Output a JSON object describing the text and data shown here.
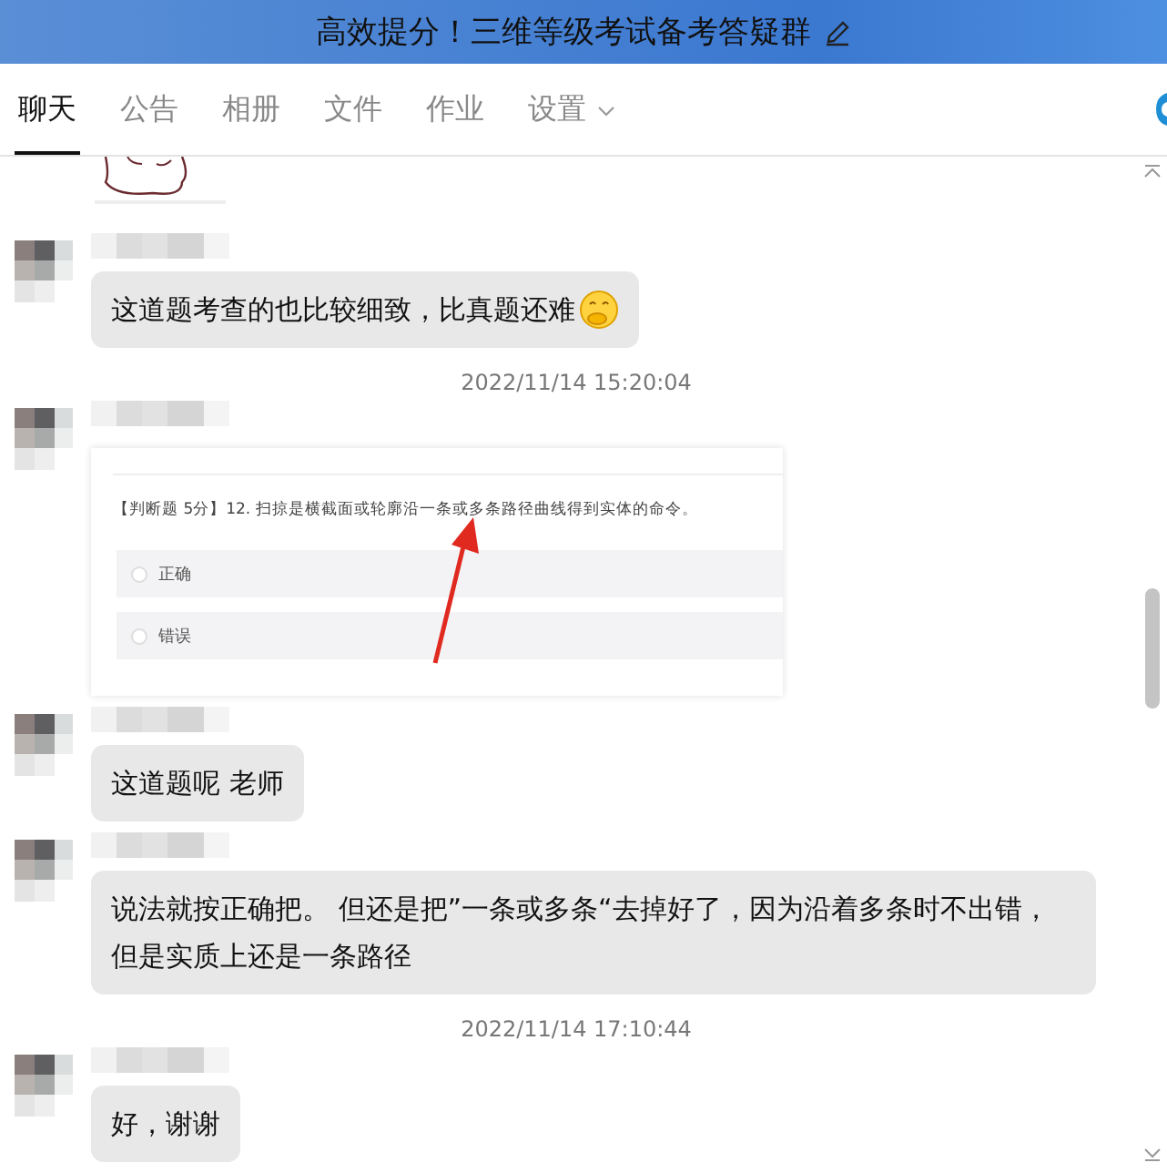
{
  "window": {
    "title": "高效提分！三维等级考试备考答疑群"
  },
  "tabs": [
    {
      "label": "聊天",
      "selected": true,
      "has_menu": false
    },
    {
      "label": "公告",
      "selected": false,
      "has_menu": false
    },
    {
      "label": "相册",
      "selected": false,
      "has_menu": false
    },
    {
      "label": "文件",
      "selected": false,
      "has_menu": false
    },
    {
      "label": "作业",
      "selected": false,
      "has_menu": false
    },
    {
      "label": "设置",
      "selected": false,
      "has_menu": true
    }
  ],
  "messages": [
    {
      "kind": "picture"
    },
    {
      "kind": "text",
      "text": "这道题考查的也比较细致，比真题还难",
      "emoji": true
    },
    {
      "kind": "time",
      "text": "2022/11/14 15:20:04"
    },
    {
      "kind": "screenshot",
      "question": "【判断题 5分】12. 扫掠是横截面或轮廓沿一条或多条路径曲线得到实体的命令。",
      "options": [
        {
          "label": "正确",
          "selected": false
        },
        {
          "label": "错误",
          "selected": false
        }
      ]
    },
    {
      "kind": "text",
      "text": "这道题呢  老师",
      "emoji": false
    },
    {
      "kind": "text",
      "text": "说法就按正确把。 但还是把”一条或多条“去掉好了，因为沿着多条时不出错，但是实质上还是一条路径",
      "emoji": false
    },
    {
      "kind": "time",
      "text": "2022/11/14 17:10:44"
    },
    {
      "kind": "text",
      "text": "好，谢谢",
      "emoji": false
    }
  ]
}
